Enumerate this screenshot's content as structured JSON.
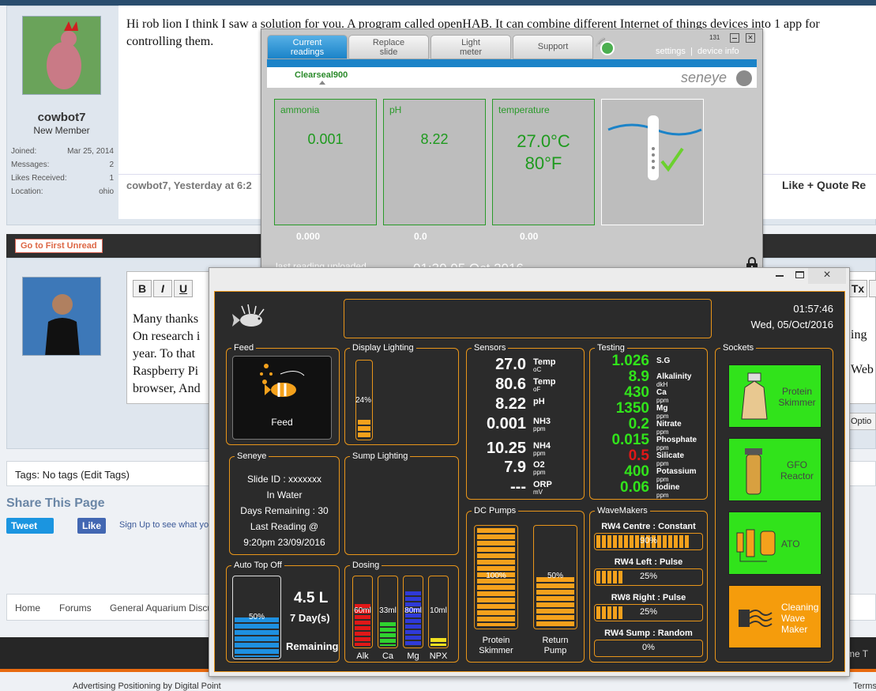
{
  "forum": {
    "post1": {
      "text": "Hi rob lion I think I saw a solution for you. A program called openHAB. It can combine different Internet of things devices into 1 app for controlling them.",
      "username": "cowbot7",
      "user_title": "New Member",
      "stats": [
        {
          "k": "Joined:",
          "v": "Mar 25, 2014"
        },
        {
          "k": "Messages:",
          "v": "2"
        },
        {
          "k": "Likes Received:",
          "v": "1"
        },
        {
          "k": "Location:",
          "v": "ohio"
        }
      ],
      "byline": "cowbot7, Yesterday at 6:2",
      "actions": "Like   + Quote   Re"
    },
    "go_first_unread": "Go to First Unread",
    "editor": {
      "bold": "B",
      "italic": "I",
      "underline": "U",
      "clear": "Tx",
      "lines": [
        "Many thanks",
        "On research i",
        "year. To that",
        "Raspberry Pi",
        "browser, And"
      ],
      "right_lines": [
        "ing",
        "Web"
      ],
      "options": "Optio"
    },
    "tags": "Tags: No tags (Edit Tags)",
    "share_title": "Share This Page",
    "tweet": "Tweet",
    "fb_like": "Like",
    "fb_text": "Sign Up to see what yo",
    "breadcrumbs": [
      "Home",
      "Forums",
      "General Aquarium Discus"
    ],
    "footer_left": "Advertising Positioning by Digital Point",
    "footer_right": "Terms",
    "footer_bar_right": "me  T"
  },
  "seneye": {
    "tabs": [
      {
        "l1": "Current",
        "l2": "readings"
      },
      {
        "l1": "Replace",
        "l2": "slide"
      },
      {
        "l1": "Light",
        "l2": "meter"
      },
      {
        "l1": "Support",
        "l2": ""
      }
    ],
    "count": "131",
    "settings": "settings",
    "sep": "|",
    "device_info": "device info",
    "device": "Clearseal900",
    "logo": "seneye",
    "panels": [
      {
        "label": "ammonia",
        "value": "0.001",
        "sub": "0.000"
      },
      {
        "label": "pH",
        "value": "8.22",
        "sub": "0.0"
      },
      {
        "label": "temperature",
        "value": "27.0°C",
        "value2": "80°F",
        "sub": "0.00"
      }
    ],
    "last_label": "last reading uploaded",
    "last_value": "01:30 05 Oct 2016"
  },
  "reef": {
    "time": "01:57:46",
    "date": "Wed, 05/Oct/2016",
    "feed": {
      "title": "Feed",
      "label": "Feed"
    },
    "display": {
      "title": "Display Lighting",
      "pct": "24%",
      "level": 0.24
    },
    "sump": {
      "title": "Sump Lighting"
    },
    "seneye": {
      "title": "Seneye",
      "lines": [
        "Slide ID : xxxxxxx",
        "In Water",
        "Days Remaining : 30",
        "Last Reading @",
        "9:20pm 23/09/2016"
      ]
    },
    "ato": {
      "title": "Auto Top Off",
      "pct": "50%",
      "level": 0.5,
      "litres": "4.5 L",
      "days": "7 Day(s)",
      "remaining": "Remaining"
    },
    "dosing": {
      "title": "Dosing",
      "items": [
        {
          "v": "60ml",
          "n": "Alk",
          "c": "#e01818",
          "level": 0.62
        },
        {
          "v": "33ml",
          "n": "Ca",
          "c": "#2fd22f",
          "level": 0.35
        },
        {
          "v": "80ml",
          "n": "Mg",
          "c": "#2f3ad8",
          "level": 0.8
        },
        {
          "v": "10ml",
          "n": "NPX",
          "c": "#f0e020",
          "level": 0.12
        }
      ]
    },
    "sensors": {
      "title": "Sensors",
      "items": [
        {
          "v": "27.0",
          "n": "Temp",
          "u": "oC"
        },
        {
          "v": "80.6",
          "n": "Temp",
          "u": "oF"
        },
        {
          "v": "8.22",
          "n": "pH",
          "u": ""
        },
        {
          "v": "0.001",
          "n": "NH3",
          "u": "ppm"
        },
        {
          "v": "10.25",
          "n": "NH4",
          "u": "ppm"
        },
        {
          "v": "7.9",
          "n": "O2",
          "u": "ppm"
        },
        {
          "v": "---",
          "n": "ORP",
          "u": "mV"
        }
      ]
    },
    "testing": {
      "title": "Testing",
      "items": [
        {
          "v": "1.026",
          "n": "S.G",
          "u": "",
          "c": "#31e31b"
        },
        {
          "v": "8.9",
          "n": "Alkalinity",
          "u": "dkH",
          "c": "#31e31b"
        },
        {
          "v": "430",
          "n": "Ca",
          "u": "ppm",
          "c": "#31e31b"
        },
        {
          "v": "1350",
          "n": "Mg",
          "u": "ppm",
          "c": "#31e31b"
        },
        {
          "v": "0.2",
          "n": "Nitrate",
          "u": "ppm",
          "c": "#31e31b"
        },
        {
          "v": "0.015",
          "n": "Phosphate",
          "u": "ppm",
          "c": "#31e31b"
        },
        {
          "v": "0.5",
          "n": "Silicate",
          "u": "ppm",
          "c": "#e01818"
        },
        {
          "v": "400",
          "n": "Potassium",
          "u": "ppm",
          "c": "#31e31b"
        },
        {
          "v": "0.06",
          "n": "Iodine",
          "u": "ppm",
          "c": "#31e31b"
        }
      ]
    },
    "pumps": {
      "title": "DC Pumps",
      "items": [
        {
          "pct": "100%",
          "level": 1.0,
          "n1": "Protein",
          "n2": "Skimmer"
        },
        {
          "pct": "50%",
          "level": 0.5,
          "n1": "Return",
          "n2": "Pump"
        }
      ]
    },
    "wave": {
      "title": "WaveMakers",
      "items": [
        {
          "name": "RW4 Centre : Constant",
          "pct": "90%",
          "level": 0.9
        },
        {
          "name": "RW4 Left : Pulse",
          "pct": "25%",
          "level": 0.25
        },
        {
          "name": "RW8 Right : Pulse",
          "pct": "25%",
          "level": 0.25
        },
        {
          "name": "RW4 Sump : Random",
          "pct": "0%",
          "level": 0
        }
      ]
    },
    "sockets": {
      "title": "Sockets",
      "items": [
        {
          "l1": "Protein",
          "l2": "Skimmer",
          "c": "#31e31b"
        },
        {
          "l1": "GFO",
          "l2": "Reactor",
          "c": "#31e31b"
        },
        {
          "l1": "ATO",
          "l2": "",
          "c": "#31e31b"
        },
        {
          "l1": "Cleaning",
          "l2": "Wave",
          "l3": "Maker",
          "c": "#f59c0c"
        }
      ]
    }
  }
}
